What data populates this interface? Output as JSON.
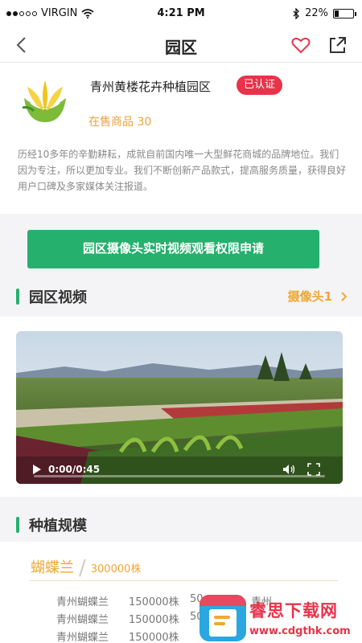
{
  "status_bar": {
    "carrier": "VIRGIN",
    "time": "4:21 PM",
    "battery_percent": "22%",
    "battery_level": 0.22
  },
  "nav": {
    "title": "园区"
  },
  "park": {
    "name": "青州黄楼花卉种植园区",
    "badge": "已认证",
    "goods_label": "在售商品",
    "goods_count": "30",
    "intro": "历经10多年的辛勤耕耘，成就自前国内唯一大型鲜花商城的品牌地位。我们因为专注，所以更加专业。我们不断创新产品款式，提高服务质量，获得良好用户口碑及多家媒体关注报道。"
  },
  "apply_button": "园区摄像头实时视频观看权限申请",
  "video_section": {
    "title": "园区视频",
    "camera_label": "摄像头1"
  },
  "video": {
    "time": "0:00/0:45",
    "progress": 0.0
  },
  "scale_section": {
    "title": "种植规模",
    "variety": "蝴蝶兰",
    "quantity": "300000株",
    "rows": [
      [
        "青州蝴蝶兰",
        "150000株",
        "50",
        "中",
        "青州"
      ],
      [
        "青州蝴蝶兰",
        "150000株",
        "50"
      ],
      [
        "青州蝴蝶兰",
        "150000株"
      ]
    ]
  },
  "watermark": {
    "title": "睿思下载网",
    "url": "www.cdgthk.com"
  },
  "colors": {
    "accent_green": "#26b06d",
    "accent_orange": "#f0a732",
    "badge_red": "#e8334a"
  },
  "icons": [
    "back-arrow-icon",
    "heart-icon",
    "share-icon",
    "chevron-right-icon",
    "play-icon",
    "volume-icon",
    "fullscreen-icon",
    "wifi-icon",
    "bluetooth-icon",
    "battery-icon"
  ]
}
